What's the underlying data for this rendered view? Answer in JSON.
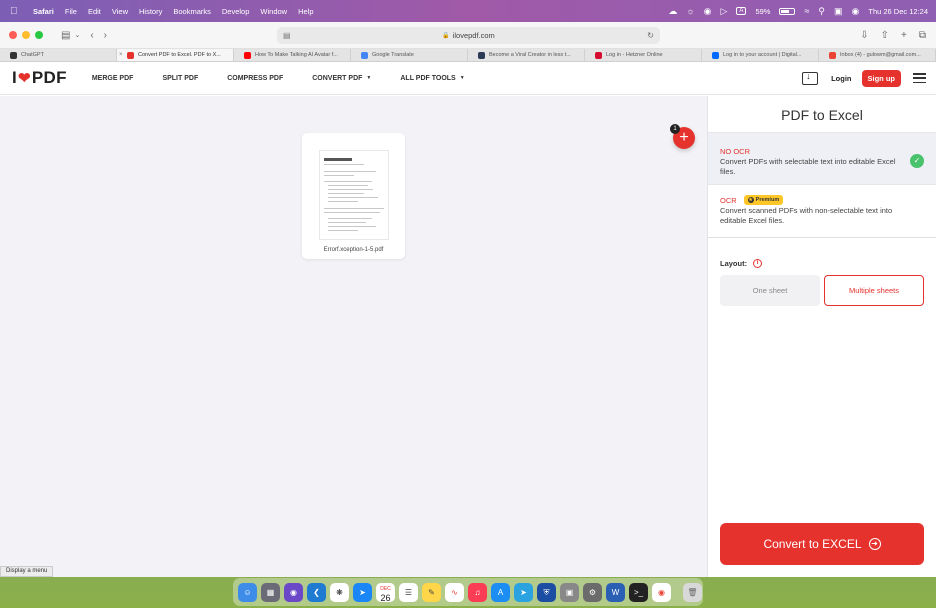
{
  "menubar": {
    "app_name": "Safari",
    "items": [
      "File",
      "Edit",
      "View",
      "History",
      "Bookmarks",
      "Develop",
      "Window",
      "Help"
    ],
    "battery": "59%",
    "input_source": "A",
    "datetime": "Thu 26 Dec  12:24"
  },
  "browser": {
    "url": "ilovepdf.com",
    "tabs": [
      {
        "label": "ChatGPT",
        "color": "#333333"
      },
      {
        "label": "Convert PDF to Excel. PDF to X...",
        "color": "#e5322d",
        "active": true
      },
      {
        "label": "How To Make Talking AI Avatar f...",
        "color": "#ff0000"
      },
      {
        "label": "Google Translate",
        "color": "#4285f4"
      },
      {
        "label": "Become a Viral Creator in less t...",
        "color": "#2b3a55"
      },
      {
        "label": "Log in - Hetzner Online",
        "color": "#d50c2d"
      },
      {
        "label": "Log in to your account | Digital...",
        "color": "#0069ff"
      },
      {
        "label": "Inbox (4) - gulowm@gmail.com...",
        "color": "#ea4335"
      }
    ]
  },
  "site": {
    "logo_left": "I",
    "logo_right": "PDF",
    "nav": [
      {
        "label": "MERGE PDF",
        "caret": false
      },
      {
        "label": "SPLIT PDF",
        "caret": false
      },
      {
        "label": "COMPRESS PDF",
        "caret": false
      },
      {
        "label": "CONVERT PDF",
        "caret": true
      },
      {
        "label": "ALL PDF TOOLS",
        "caret": true
      }
    ],
    "login": "Login",
    "signup": "Sign up"
  },
  "workspace": {
    "file_name": "Errorf.xception-1-5.pdf",
    "file_count_badge": "1",
    "status_text": "Display a menu"
  },
  "sidebar": {
    "title": "PDF to Excel",
    "no_ocr_title": "NO OCR",
    "no_ocr_desc": "Convert PDFs with selectable text into editable Excel files.",
    "ocr_title": "OCR",
    "premium_label": "Premium",
    "ocr_desc": "Convert scanned PDFs with non-selectable text into editable Excel files.",
    "layout_label": "Layout:",
    "layout_options": [
      "One sheet",
      "Multiple sheets"
    ],
    "layout_selected": "Multiple sheets",
    "convert_label": "Convert to EXCEL"
  },
  "dock": {
    "calendar_month": "DEC",
    "calendar_day": "26"
  },
  "colors": {
    "brand_red": "#e5322d",
    "success_green": "#48c26b",
    "premium_yellow": "#ffc628"
  }
}
